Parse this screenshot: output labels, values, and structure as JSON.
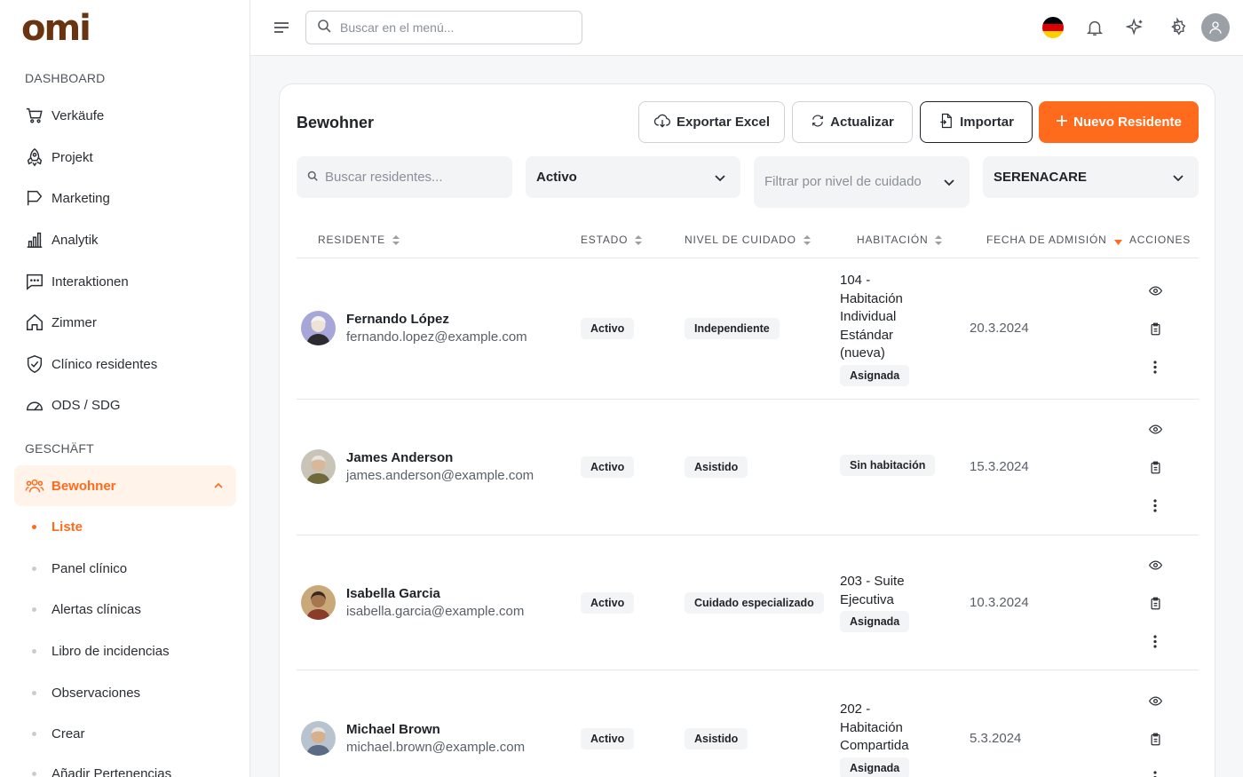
{
  "brand": {
    "logo_text": "omi"
  },
  "sidebar": {
    "section_dashboard": "DASHBOARD",
    "section_business": "GESCHÄFT",
    "items": [
      {
        "label": "Verkäufe",
        "icon": "cart-icon"
      },
      {
        "label": "Projekt",
        "icon": "rocket-icon"
      },
      {
        "label": "Marketing",
        "icon": "flag-icon"
      },
      {
        "label": "Analytik",
        "icon": "bar-chart-icon"
      },
      {
        "label": "Interaktionen",
        "icon": "chat-icon"
      },
      {
        "label": "Zimmer",
        "icon": "home-icon"
      },
      {
        "label": "Clínico residentes",
        "icon": "shield-check-icon"
      },
      {
        "label": "ODS / SDG",
        "icon": "gauge-icon"
      }
    ],
    "active_group": {
      "label": "Bewohner",
      "icon": "users-icon"
    },
    "sub_items": [
      {
        "label": "Liste",
        "active": true
      },
      {
        "label": "Panel clínico"
      },
      {
        "label": "Alertas clínicas"
      },
      {
        "label": "Libro de incidencias"
      },
      {
        "label": "Observaciones"
      },
      {
        "label": "Crear"
      },
      {
        "label": "Añadir Pertenencias"
      }
    ]
  },
  "topbar": {
    "search_placeholder": "Buscar en el menú..."
  },
  "page": {
    "title": "Bewohner",
    "buttons": {
      "export": "Exportar Excel",
      "refresh": "Actualizar",
      "import": "Importar",
      "new": "Nuevo Residente"
    },
    "filters": {
      "search_placeholder": "Buscar residentes...",
      "status": "Activo",
      "care_placeholder": "Filtrar por nivel de cuidado",
      "facility": "SERENACARE"
    },
    "columns": [
      "RESIDENTE",
      "ESTADO",
      "NIVEL DE CUIDADO",
      "HABITACIÓN",
      "FECHA DE ADMISIÓN",
      "ACCIONES"
    ],
    "rows": [
      {
        "name": "Fernando López",
        "email": "fernando.lopez@example.com",
        "status": "Activo",
        "care": "Independiente",
        "room": "104 - Habitación Individual Estándar (nueva)",
        "room_badge": "Asignada",
        "date": "20.3.2024"
      },
      {
        "name": "James Anderson",
        "email": "james.anderson@example.com",
        "status": "Activo",
        "care": "Asistido",
        "room": "",
        "room_badge": "Sin habitación",
        "date": "15.3.2024"
      },
      {
        "name": "Isabella Garcia",
        "email": "isabella.garcia@example.com",
        "status": "Activo",
        "care": "Cuidado especializado",
        "room": "203 - Suite Ejecutiva",
        "room_badge": "Asignada",
        "date": "10.3.2024"
      },
      {
        "name": "Michael Brown",
        "email": "michael.brown@example.com",
        "status": "Activo",
        "care": "Asistido",
        "room": "202 - Habitación Compartida",
        "room_badge": "Asignada",
        "date": "5.3.2024"
      }
    ]
  },
  "colors": {
    "accent": "#ff6b1c",
    "accent_bg": "#fff3ea",
    "brand": "#6b3410"
  }
}
